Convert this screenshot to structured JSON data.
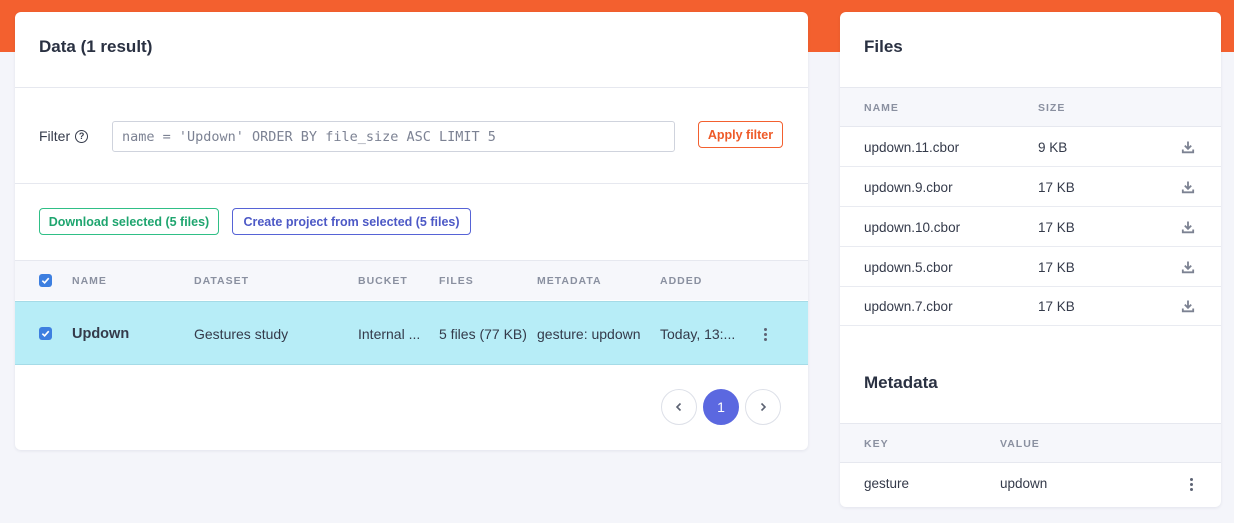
{
  "colors": {
    "brand": "#f3602f",
    "selected_row": "#b7edf7",
    "primary": "#5b68e0",
    "success": "#2fbf86"
  },
  "data_panel": {
    "title": "Data (1 result)",
    "filter": {
      "label": "Filter",
      "help_icon": "help-circle-icon",
      "value": "name = 'Updown' ORDER BY file_size ASC LIMIT 5",
      "apply_label": "Apply filter"
    },
    "actions": {
      "download_label": "Download selected (5 files)",
      "create_project_label": "Create project from selected (5 files)"
    },
    "table": {
      "columns": [
        "NAME",
        "DATASET",
        "BUCKET",
        "FILES",
        "METADATA",
        "ADDED"
      ],
      "rows": [
        {
          "selected": true,
          "name": "Updown",
          "dataset": "Gestures study",
          "bucket": "Internal ...",
          "files": "5 files (77 KB)",
          "metadata": "gesture: updown",
          "added": "Today, 13:..."
        }
      ]
    },
    "pagination": {
      "prev_icon": "chevron-left-icon",
      "current_page": "1",
      "next_icon": "chevron-right-icon"
    }
  },
  "files_panel": {
    "title": "Files",
    "columns": [
      "NAME",
      "SIZE"
    ],
    "rows": [
      {
        "name": "updown.11.cbor",
        "size": "9 KB"
      },
      {
        "name": "updown.9.cbor",
        "size": "17 KB"
      },
      {
        "name": "updown.10.cbor",
        "size": "17 KB"
      },
      {
        "name": "updown.5.cbor",
        "size": "17 KB"
      },
      {
        "name": "updown.7.cbor",
        "size": "17 KB"
      }
    ],
    "row_icon": "download-icon"
  },
  "metadata_panel": {
    "title": "Metadata",
    "columns": [
      "KEY",
      "VALUE"
    ],
    "rows": [
      {
        "key": "gesture",
        "value": "updown"
      }
    ]
  }
}
